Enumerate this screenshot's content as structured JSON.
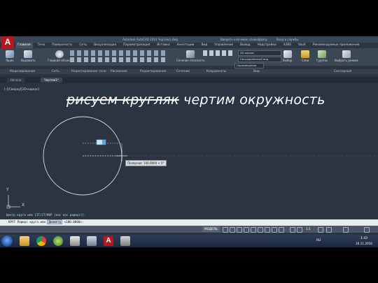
{
  "window": {
    "title": "Autodesk AutoCAD 2014   Чертеж1.dwg",
    "search_placeholder": "Введите ключевое слово/фразу",
    "signin_label": "Вход в службы"
  },
  "app_logo": "A",
  "ribbon_tabs": [
    "Главная",
    "Тело",
    "Поверхность",
    "Сеть",
    "Визуализация",
    "Параметризация",
    "Вставка",
    "Аннотации",
    "Вид",
    "Управление",
    "Вывод",
    "Надстройки",
    "A360",
    "Vault",
    "Рекомендуемые приложения"
  ],
  "ribbon": {
    "buttons": [
      {
        "label": "Ящик"
      },
      {
        "label": "Выдавить"
      },
      {
        "label": "Гладкий объект"
      },
      {
        "label": "Сечение плоскость"
      },
      {
        "label": "Выбор"
      },
      {
        "label": "Слои"
      },
      {
        "label": "Группы"
      },
      {
        "label": "Выбрать режим"
      }
    ],
    "view_style": "2D-каркас",
    "visual_style": "Несохраненный вид",
    "gizmo": "Перемещение",
    "panels": [
      "Моделирование",
      "Сеть",
      "Редактирование тела",
      "Рисование",
      "Редактирование",
      "Сечение",
      "Координаты",
      "Вид",
      "Сенсорный"
    ]
  },
  "file_tabs": [
    "Начало",
    "Чертеж1*"
  ],
  "viewport_label": "[–][Сверху][2D-каркас]",
  "annotation": {
    "struck": "рисуем кругляк",
    "text": "чертим окружность"
  },
  "tooltip": "Полярная: 100.0000 < 0°",
  "ucs": {
    "x": "X",
    "y": "Y"
  },
  "command": {
    "history": "Центр круга или [3Т/2Т/ККР (кас кас радиус)]:",
    "prompt": "КРУГ Радиус круга или",
    "option": "Диаметр",
    "value": "<100.0000>:"
  },
  "status": {
    "model": "МОДЕЛЬ",
    "scale": "1:1"
  },
  "taskbar": {
    "lang": "RU",
    "time": "1:43",
    "date": "16.11.2016"
  },
  "colors": {
    "canvas": "#2b3440",
    "accent_red": "#b3191c"
  }
}
